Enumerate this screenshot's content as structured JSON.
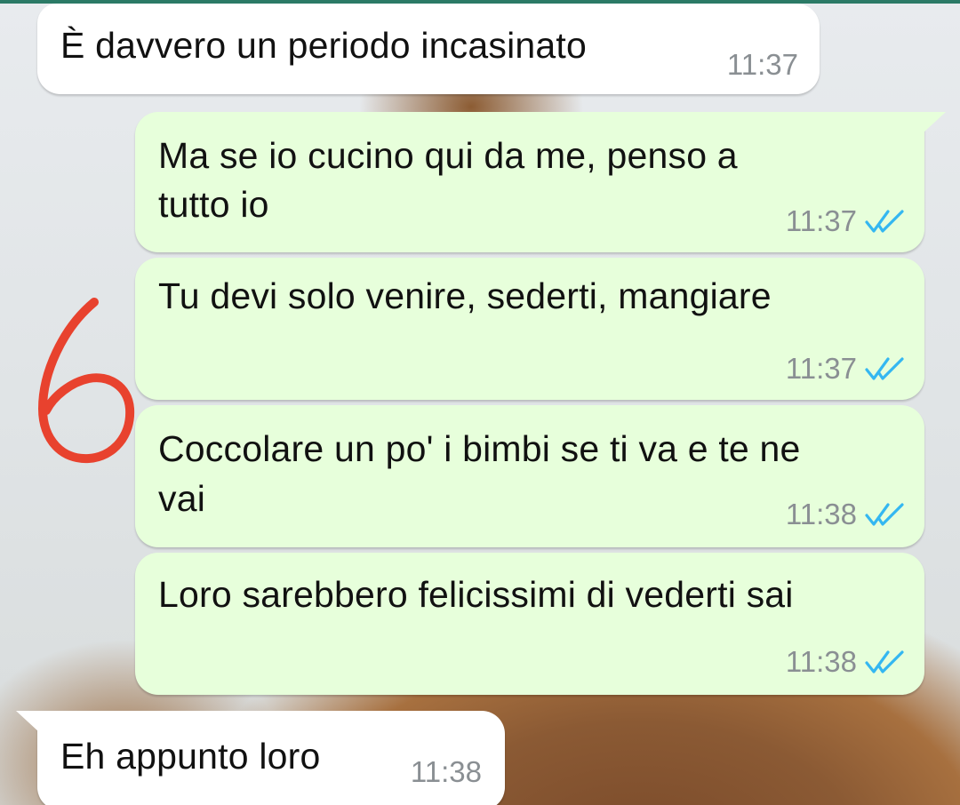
{
  "messages": [
    {
      "direction": "in",
      "text": "È davvero un periodo incasinato",
      "time": "11:37"
    },
    {
      "direction": "out",
      "text_lines": [
        "Ma se io cucino qui da me, penso a",
        "tutto io"
      ],
      "time": "11:37",
      "status": "read-double-check-icon"
    },
    {
      "direction": "out",
      "text": "Tu devi solo venire, sederti, mangiare",
      "time": "11:37",
      "status": "read-double-check-icon"
    },
    {
      "direction": "out",
      "text_lines": [
        "Coccolare un po' i bimbi se ti va e te ne",
        "vai"
      ],
      "time": "11:38",
      "status": "read-double-check-icon"
    },
    {
      "direction": "out",
      "text": "Loro sarebbero felicissimi di vederti sai",
      "time": "11:38",
      "status": "read-double-check-icon"
    },
    {
      "direction": "in",
      "text": "Eh appunto loro",
      "time": "11:38"
    }
  ],
  "annotation": {
    "text": "6",
    "color": "#e8422e"
  },
  "colors": {
    "incoming_bubble": "#ffffff",
    "outgoing_bubble": "#e7ffdb",
    "read_ticks": "#34b7f1",
    "timestamp": "#8a8f93"
  }
}
